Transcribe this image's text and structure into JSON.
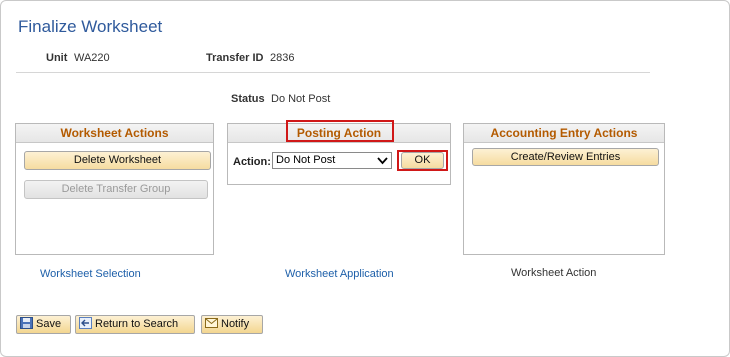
{
  "page": {
    "title": "Finalize Worksheet"
  },
  "fields": {
    "unit_label": "Unit",
    "unit_value": "WA220",
    "transfer_label": "Transfer ID",
    "transfer_value": "2836",
    "status_label": "Status",
    "status_value": "Do Not Post"
  },
  "worksheet_actions": {
    "title": "Worksheet Actions",
    "delete_worksheet": "Delete Worksheet",
    "delete_transfer_group": "Delete Transfer Group"
  },
  "posting_action": {
    "title": "Posting Action",
    "action_label": "Action:",
    "action_value": "Do Not Post",
    "ok_label": "OK"
  },
  "accounting_entry_actions": {
    "title": "Accounting Entry Actions",
    "create_review": "Create/Review Entries"
  },
  "nav": {
    "worksheet_selection": "Worksheet Selection",
    "worksheet_application": "Worksheet Application",
    "worksheet_action": "Worksheet Action"
  },
  "toolbar": {
    "save": "Save",
    "return_to_search": "Return to Search",
    "notify": "Notify"
  },
  "colors": {
    "title": "#2f5a9c",
    "section_header": "#b35a00",
    "highlight": "#d01818",
    "link": "#1d5fa9"
  },
  "icons": [
    "save-icon",
    "return-to-search-icon",
    "notify-icon",
    "chevron-down-icon"
  ]
}
